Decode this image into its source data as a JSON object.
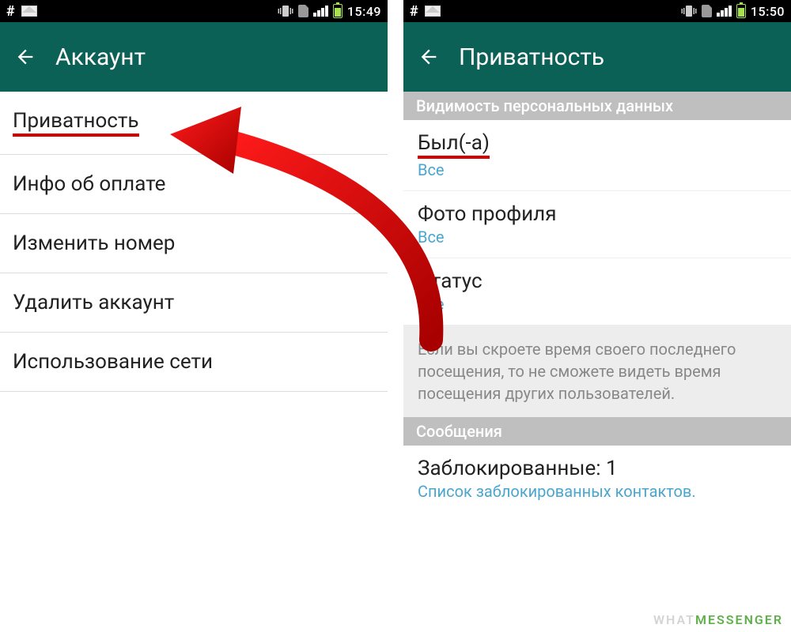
{
  "left": {
    "statusbar": {
      "time": "15:49",
      "hash": "#"
    },
    "appbar": {
      "title": "Аккаунт"
    },
    "items": [
      "Приватность",
      "Инфо об оплате",
      "Изменить номер",
      "Удалить аккаунт",
      "Использование сети"
    ]
  },
  "right": {
    "statusbar": {
      "time": "15:50",
      "hash": "#"
    },
    "appbar": {
      "title": "Приватность"
    },
    "section1": "Видимость персональных данных",
    "prefs": [
      {
        "title": "Был(-а)",
        "sub": "Все"
      },
      {
        "title": "Фото профиля",
        "sub": "Все"
      },
      {
        "title": "Статус",
        "sub": "Все"
      }
    ],
    "note": "Если вы скроете время своего последнего посещения, то не сможете видеть время посещения других пользователей.",
    "section2": "Сообщения",
    "blocked": {
      "title": "Заблокированные: 1",
      "sub": "Список заблокированных контактов."
    }
  },
  "watermark": {
    "a": "WHAT",
    "b": "MESSENGER"
  }
}
